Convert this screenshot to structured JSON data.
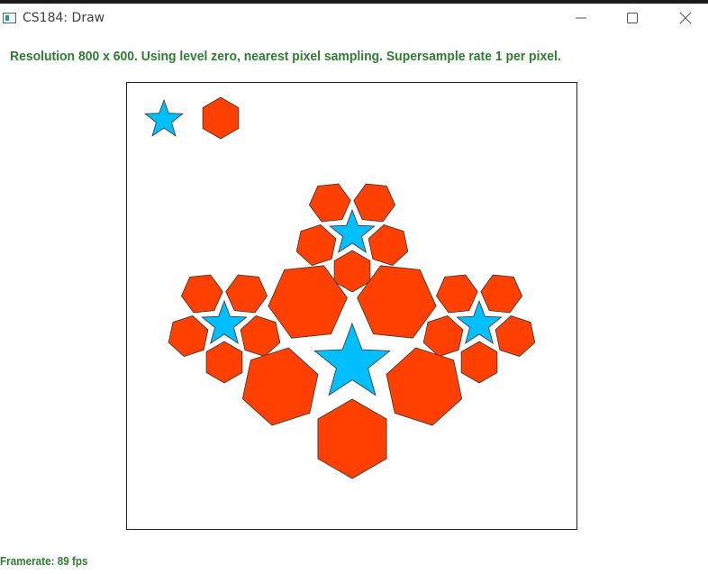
{
  "window": {
    "title": "CS184: Draw"
  },
  "status": {
    "text": "Resolution 800 x 600. Using level zero, nearest pixel sampling. Supersample rate 1 per pixel."
  },
  "framerate": {
    "text": "Framerate: 89 fps"
  },
  "colors": {
    "star_fill": "#00bfff",
    "hexagon_fill": "#ff4000",
    "outline": "#333333",
    "status_text": "#2e7d32"
  },
  "icons": {
    "minimize": "minimize-icon",
    "maximize": "maximize-icon",
    "close": "close-icon",
    "app": "app-icon"
  }
}
